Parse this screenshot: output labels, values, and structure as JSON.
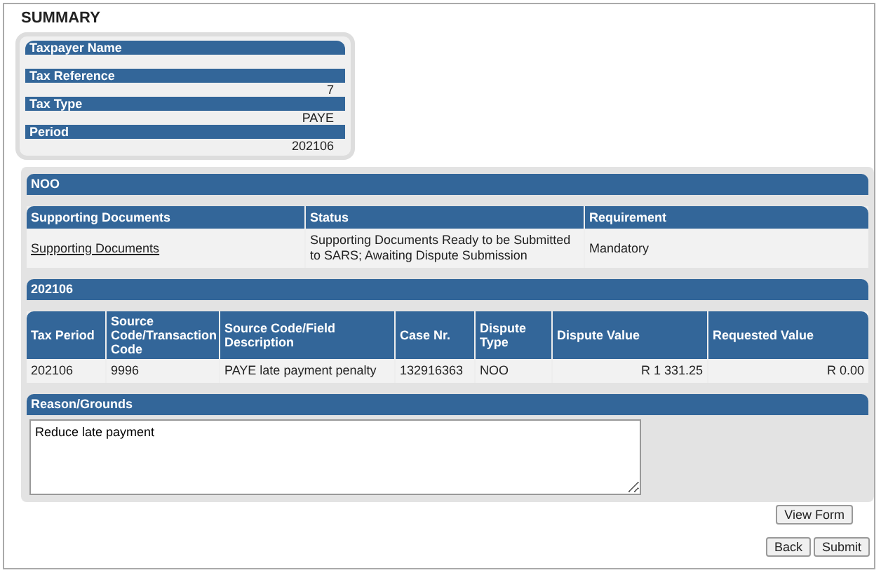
{
  "title": "SUMMARY",
  "summary": [
    {
      "label": "Taxpayer Name"
    },
    {
      "label": "Tax Reference",
      "value": "7"
    },
    {
      "label": "Tax Type",
      "value": "PAYE"
    },
    {
      "label": "Period",
      "value": "202106"
    }
  ],
  "dispute_type_header": "NOO",
  "documents": {
    "columns": [
      "Supporting Documents",
      "Status",
      "Requirement"
    ],
    "rows": [
      {
        "link": "Supporting Documents",
        "status": "Supporting Documents Ready to be Submitted to SARS; Awaiting Dispute Submission",
        "requirement": "Mandatory"
      }
    ]
  },
  "period_header": "202106",
  "transactions": {
    "columns": [
      "Tax Period",
      "Source Code/Transaction Code",
      "Source Code/Field Description",
      "Case Nr.",
      "Dispute Type",
      "Dispute Value",
      "Requested Value"
    ],
    "rows": [
      [
        "202106",
        "9996",
        "PAYE late payment penalty",
        "132916363",
        "NOO",
        "R 1 331.25",
        "R 0.00"
      ]
    ]
  },
  "reason": {
    "label": "Reason/Grounds",
    "value": "Reduce late payment"
  },
  "buttons": {
    "view_form": "View Form",
    "back": "Back",
    "submit": "Submit"
  }
}
